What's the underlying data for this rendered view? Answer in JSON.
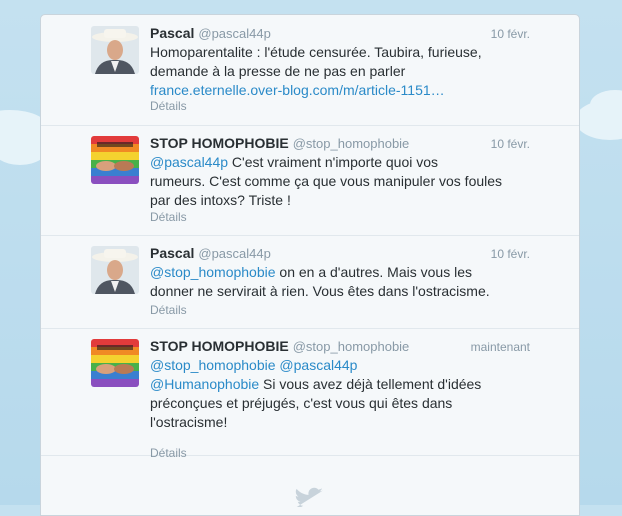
{
  "tweets": [
    {
      "author": "Pascal",
      "handle": "@pascal44p",
      "time": "10 févr.",
      "text_line1": "Homoparentalite : l'étude censurée. Taubira, furieuse,",
      "text_line2": "demande à la presse de ne pas en parler",
      "link": "france.eternelle.over-blog.com/m/article-1151…",
      "details": "Détails",
      "avatar": "cowboy-portrait"
    },
    {
      "author": "STOP HOMOPHOBIE",
      "handle": "@stop_homophobie",
      "time": "10 févr.",
      "mention": "@pascal44p",
      "text_line1_rest": " C'est vraiment n'importe quoi vos",
      "text_line2": "rumeurs. C'est comme ça que vous manipuler vos foules",
      "text_line3": "par des intoxs? Triste !",
      "details": "Détails",
      "avatar": "rainbow-hands"
    },
    {
      "author": "Pascal",
      "handle": "@pascal44p",
      "time": "10 févr.",
      "mention": "@stop_homophobie",
      "text_line1_rest": " on en a d'autres. Mais vous les",
      "text_line2": "donner ne servirait à rien. Vous êtes dans l'ostracisme.",
      "details": "Détails",
      "avatar": "cowboy-portrait"
    },
    {
      "author": "STOP HOMOPHOBIE",
      "handle": "@stop_homophobie",
      "time": "maintenant",
      "mention1": "@stop_homophobie",
      "mention2": "@pascal44p",
      "mention3": "@Humanophobie",
      "text_line3_rest": " Si vous avez déjà tellement d'idées",
      "text_line4": "préconçues et préjugés, c'est vous qui êtes dans",
      "text_line5": "l'ostracisme!",
      "details": "Détails",
      "avatar": "rainbow-hands"
    }
  ],
  "footer_icon": "twitter-bird-icon",
  "colors": {
    "link": "#2a8ac8",
    "name": "#292f33",
    "muted": "#8899a6",
    "panel": "#f5f8fa",
    "background": "#c4e1f0"
  }
}
